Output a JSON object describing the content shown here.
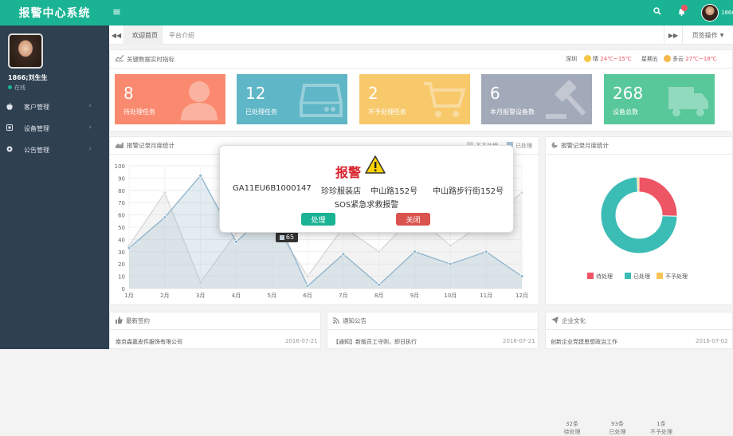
{
  "app": {
    "title": "报警中心系统",
    "username_short": "1866",
    "username_full": "1866;刘生生",
    "status": "在线"
  },
  "sidebar": {
    "items": [
      {
        "label": "客户管理",
        "icon": "apple-icon"
      },
      {
        "label": "设备管理",
        "icon": "device-icon"
      },
      {
        "label": "公告管理",
        "icon": "circle-icon"
      }
    ]
  },
  "tabs": {
    "home": "欢迎首页",
    "intro": "平台介绍",
    "tab_ops": "页签操作"
  },
  "kpi_panel": {
    "title": "关键数据实时指标"
  },
  "weather": {
    "city": "深圳",
    "today": "晴",
    "today_temp": "24℃~15℃",
    "weekday": "星期五",
    "tomorrow": "多云",
    "tomorrow_temp": "27℃~18℃"
  },
  "cards": [
    {
      "num": "8",
      "label": "待处理任务",
      "color": "#f8ac59",
      "icon": "user-icon"
    },
    {
      "num": "12",
      "label": "已处理任务",
      "color": "#23c6c8",
      "icon": "hdd-icon"
    },
    {
      "num": "2",
      "label": "不予处理任务",
      "color": "#f8ac59",
      "icon": "cart-icon"
    },
    {
      "num": "6",
      "label": "本月报警设备数",
      "color": "#9aa6b8",
      "icon": "gavel-icon"
    },
    {
      "num": "268",
      "label": "设备总数",
      "color": "#1ab394",
      "icon": "truck-icon"
    }
  ],
  "line_panel": {
    "title": "报警记录月度统计",
    "legend_a": "不予处理",
    "legend_b": "已处理"
  },
  "tooltip": {
    "value": "65"
  },
  "pie_panel": {
    "title": "报警记录月度统计",
    "stats": [
      {
        "value": "32条",
        "label": "待处理"
      },
      {
        "value": "93条",
        "label": "已处理"
      },
      {
        "value": "1条",
        "label": "不予处理"
      }
    ]
  },
  "chart_data": [
    {
      "type": "line",
      "x": [
        "1月",
        "2月",
        "3月",
        "4月",
        "5月",
        "6月",
        "7月",
        "8月",
        "9月",
        "10月",
        "11月",
        "12月"
      ],
      "ylim": [
        0,
        100
      ],
      "yticks": [
        0,
        10,
        20,
        30,
        40,
        50,
        60,
        70,
        80,
        90,
        100
      ],
      "series": [
        {
          "name": "不予处理",
          "values": [
            35,
            78,
            5,
            45,
            55,
            10,
            50,
            30,
            60,
            35,
            55,
            78
          ]
        },
        {
          "name": "已处理",
          "values": [
            33,
            58,
            92,
            38,
            65,
            2,
            28,
            3,
            30,
            20,
            30,
            10
          ]
        }
      ]
    },
    {
      "type": "pie",
      "labels": [
        "待处理",
        "已处理",
        "不予处理"
      ],
      "values": [
        32,
        93,
        1
      ]
    }
  ],
  "modal": {
    "title": "报警",
    "device": "GA11EU6B1000147",
    "shop": "珍珍服装店",
    "addr1": "中山路152号",
    "addr2": "中山路步行街152号",
    "desc": "SOS紧急求救报警",
    "ok": "处理",
    "close": "关闭"
  },
  "sign_panel": {
    "title": "最新签约",
    "item": "南京森嘉皮件服饰有限公司",
    "date": "2016-07-21"
  },
  "notice_panel": {
    "title": "通知公告",
    "item": "【通知】新版员工守则，即日执行",
    "date": "2016-07-21"
  },
  "culture_panel": {
    "title": "企业文化",
    "item": "创新企业党建思想政治工作",
    "date": "2016-07-02"
  },
  "colors": {
    "green": "#1ab394",
    "sidebar": "#2f4050",
    "red": "#ed5565",
    "pie_red": "#ed5565",
    "pie_teal": "#3bbcb5",
    "pie_yellow": "#f8c455",
    "line_a": "#d6d6d6",
    "line_b": "#8eb4cc"
  }
}
